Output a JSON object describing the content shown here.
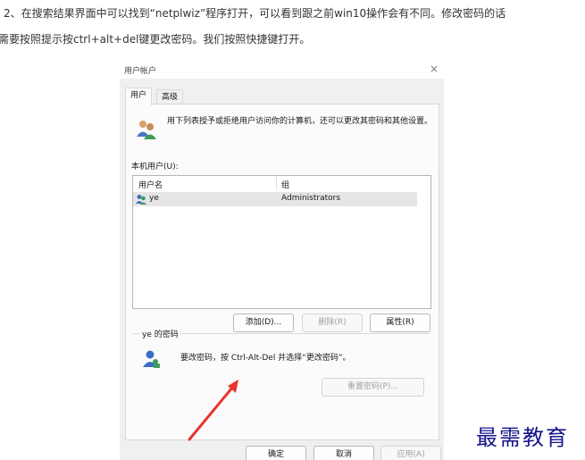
{
  "article": {
    "line1": "2、在搜索结果界面中可以找到“netplwiz”程序打开，可以看到跟之前win10操作会有不同。修改密码的话",
    "line2": "需要按照提示按ctrl+alt+del键更改密码。我们按照快捷键打开。"
  },
  "dialog": {
    "title": "用户帐户",
    "close_glyph": "×",
    "tabs": [
      "用户",
      "高级"
    ],
    "intro": "用下列表授予或拒绝用户访问你的计算机，还可以更改其密码和其他设置。",
    "local_users_label": "本机用户(U):",
    "columns": [
      "用户名",
      "组"
    ],
    "rows": [
      {
        "user": "ye",
        "group": "Administrators"
      }
    ],
    "buttons": {
      "add": "添加(D)...",
      "remove": "删除(R)",
      "properties": "属性(R)"
    },
    "password_group": {
      "title": "ye 的密码",
      "text": "要改密码，按 Ctrl-Alt-Del 并选择“更改密码”。",
      "reset": "重置密码(P)..."
    },
    "footer": {
      "ok": "确定",
      "cancel": "取消",
      "apply": "应用(A)"
    }
  },
  "watermark": "最需教育",
  "colors": {
    "annotation_arrow": "#e8342a",
    "watermark": "#15158a"
  }
}
